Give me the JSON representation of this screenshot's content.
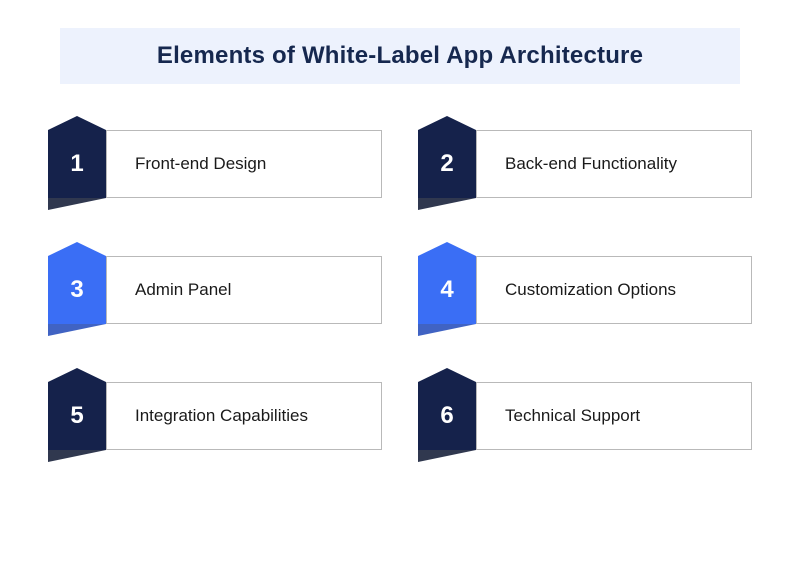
{
  "title": "Elements of White-Label App Architecture",
  "colors": {
    "dark": "#15224b",
    "blue": "#3a6ef5",
    "titleBg": "#edf2fd"
  },
  "items": [
    {
      "num": "1",
      "label": "Front-end Design",
      "variant": "dark"
    },
    {
      "num": "2",
      "label": "Back-end Functionality",
      "variant": "dark"
    },
    {
      "num": "3",
      "label": "Admin Panel",
      "variant": "blue"
    },
    {
      "num": "4",
      "label": "Customization Options",
      "variant": "blue"
    },
    {
      "num": "5",
      "label": "Integration Capabilities",
      "variant": "dark"
    },
    {
      "num": "6",
      "label": "Technical Support",
      "variant": "dark"
    }
  ]
}
